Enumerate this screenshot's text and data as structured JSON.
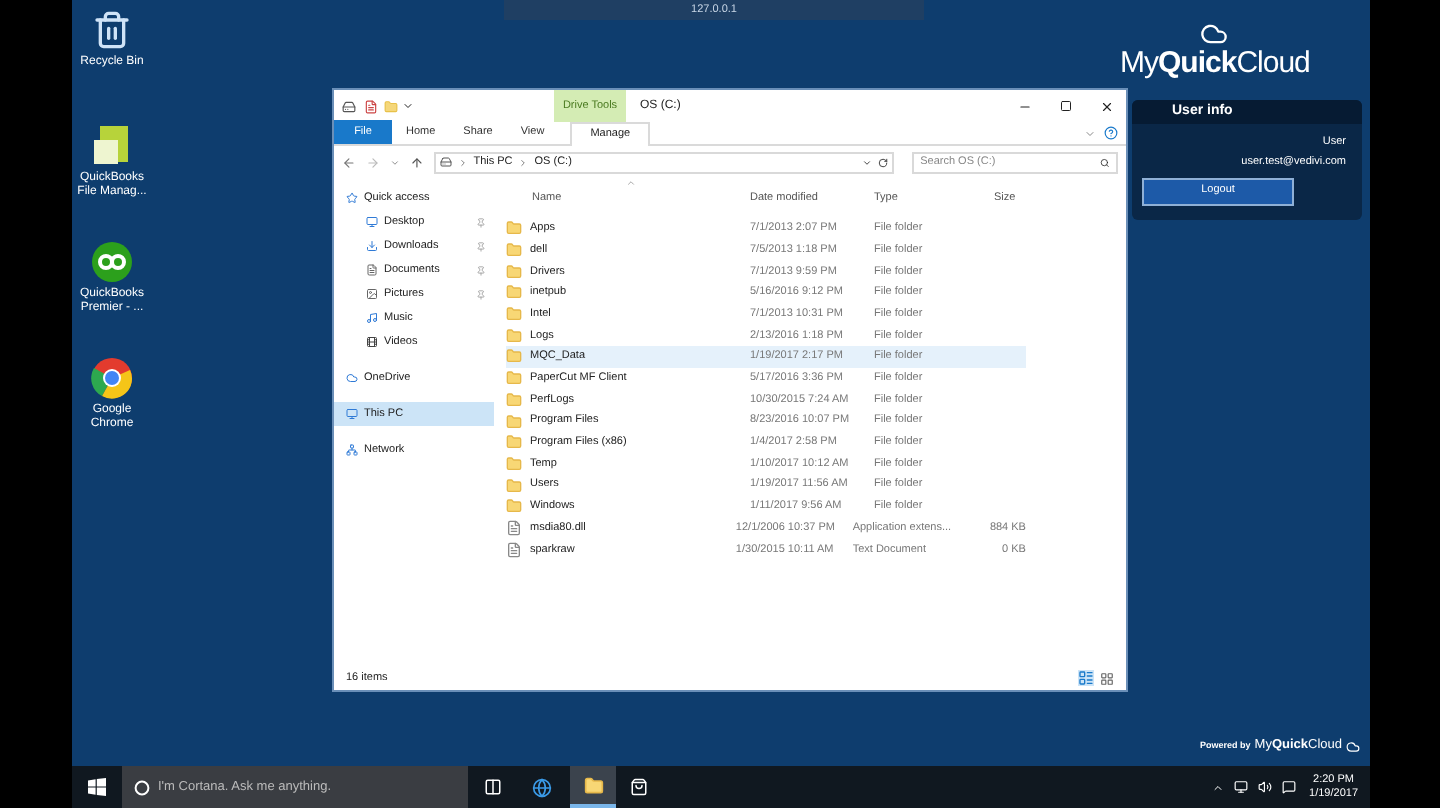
{
  "remote_bar": {
    "title": "127.0.0.1"
  },
  "desktop_icons": [
    {
      "label": "Recycle Bin"
    },
    {
      "label": "QuickBooks File Manag..."
    },
    {
      "label": "QuickBooks Premier - ..."
    },
    {
      "label": "Google Chrome"
    }
  ],
  "explorer": {
    "context_tab": "Drive Tools",
    "title": "OS (C:)",
    "ribbon_tabs": [
      {
        "kind": "menu",
        "label": "File",
        "selected": false
      },
      {
        "kind": "tab",
        "label": "Home",
        "selected": false
      },
      {
        "kind": "tab",
        "label": "Share",
        "selected": false
      },
      {
        "kind": "tab",
        "label": "View",
        "selected": false
      },
      {
        "kind": "tab",
        "label": "Manage",
        "selected": true
      }
    ],
    "path": [
      "This PC",
      "OS (C:)"
    ],
    "search": {
      "placeholder": "Search OS (C:)"
    },
    "nav": [
      {
        "label": "Quick access",
        "pinned": false,
        "selected": false
      },
      {
        "label": "Desktop",
        "pinned": true,
        "selected": false
      },
      {
        "label": "Downloads",
        "pinned": true,
        "selected": false
      },
      {
        "label": "Documents",
        "pinned": true,
        "selected": false
      },
      {
        "label": "Pictures",
        "pinned": true,
        "selected": false
      },
      {
        "label": "Music",
        "pinned": false,
        "selected": false
      },
      {
        "label": "Videos",
        "pinned": false,
        "selected": false
      },
      {
        "label": "OneDrive",
        "pinned": false,
        "selected": false
      },
      {
        "label": "This PC",
        "pinned": false,
        "selected": true
      },
      {
        "label": "Network",
        "pinned": false,
        "selected": false
      }
    ],
    "columns": [
      "Name",
      "Date modified",
      "Type",
      "Size"
    ],
    "rows": [
      {
        "kind": "folder",
        "name": "Apps",
        "date": "7/1/2013 2:07 PM",
        "type": "File folder",
        "selected": false
      },
      {
        "kind": "folder",
        "name": "dell",
        "date": "7/5/2013 1:18 PM",
        "type": "File folder",
        "selected": false
      },
      {
        "kind": "folder",
        "name": "Drivers",
        "date": "7/1/2013 9:59 PM",
        "type": "File folder",
        "selected": false
      },
      {
        "kind": "folder",
        "name": "inetpub",
        "date": "5/16/2016 9:12 PM",
        "type": "File folder",
        "selected": false
      },
      {
        "kind": "folder",
        "name": "Intel",
        "date": "7/1/2013 10:31 PM",
        "type": "File folder",
        "selected": false
      },
      {
        "kind": "folder",
        "name": "Logs",
        "date": "2/13/2016 1:18 PM",
        "type": "File folder",
        "selected": false
      },
      {
        "kind": "folder",
        "name": "MQC_Data",
        "date": "1/19/2017 2:17 PM",
        "type": "File folder",
        "selected": true
      },
      {
        "kind": "folder",
        "name": "PaperCut MF Client",
        "date": "5/17/2016 3:36 PM",
        "type": "File folder",
        "selected": false
      },
      {
        "kind": "folder",
        "name": "PerfLogs",
        "date": "10/30/2015 7:24 AM",
        "type": "File folder",
        "selected": false
      },
      {
        "kind": "folder",
        "name": "Program Files",
        "date": "8/23/2016 10:07 PM",
        "type": "File folder",
        "selected": false
      },
      {
        "kind": "folder",
        "name": "Program Files (x86)",
        "date": "1/4/2017 2:58 PM",
        "type": "File folder",
        "selected": false
      },
      {
        "kind": "folder",
        "name": "Temp",
        "date": "1/10/2017 10:12 AM",
        "type": "File folder",
        "selected": false
      },
      {
        "kind": "folder",
        "name": "Users",
        "date": "1/19/2017 11:56 AM",
        "type": "File folder",
        "selected": false
      },
      {
        "kind": "folder",
        "name": "Windows",
        "date": "1/11/2017 9:56 AM",
        "type": "File folder",
        "selected": false
      },
      {
        "kind": "file",
        "name": "msdia80.dll",
        "date": "12/1/2006 10:37 PM",
        "type": "Application extens...",
        "size": "884 KB",
        "selected": false
      },
      {
        "kind": "file",
        "name": "sparkraw",
        "date": "1/30/2015 10:11 AM",
        "type": "Text Document",
        "size": "0 KB",
        "selected": false
      }
    ],
    "status": "16 items"
  },
  "logo": "My**Quick**Cloud",
  "user_info": {
    "title": "User info",
    "user": "User",
    "email": "user.test@vedivi.com",
    "button": "Logout"
  },
  "powered_by": {
    "label": "Powered by",
    "logo": "My**Quick**Cloud"
  },
  "taskbar": {
    "search_placeholder": "I'm Cortana. Ask me anything.",
    "time": "2:20 PM",
    "date": "1/19/2017"
  }
}
